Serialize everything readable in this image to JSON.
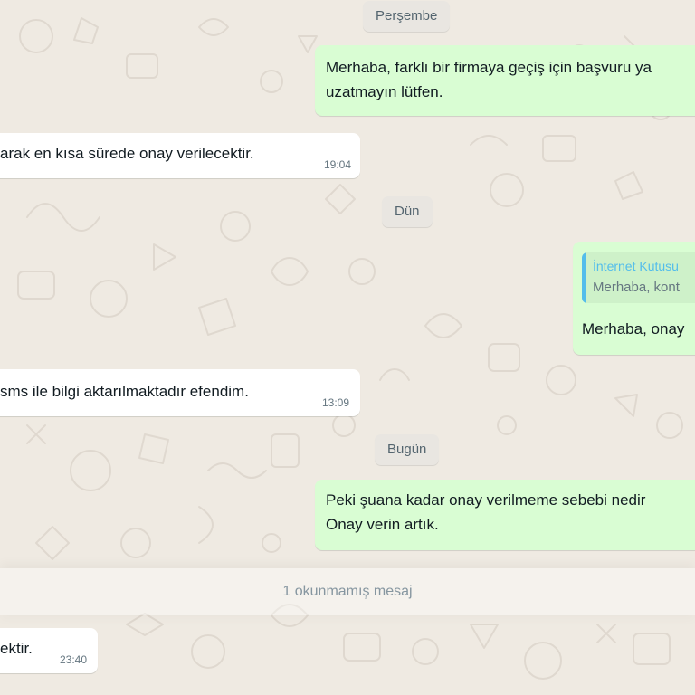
{
  "date_dividers": {
    "thursday": "Perşembe",
    "yesterday": "Dün",
    "today": "Bugün"
  },
  "messages": [
    {
      "direction": "out",
      "lines": [
        "Merhaba, farklı bir firmaya geçiş için başvuru ya",
        "uzatmayın lütfen."
      ]
    },
    {
      "direction": "in",
      "text": "arak en kısa sürede onay verilecektir.",
      "time": "19:04"
    },
    {
      "direction": "out",
      "quote": {
        "author": "İnternet Kutusu",
        "text": "Merhaba, kont"
      },
      "text": "Merhaba, onay"
    },
    {
      "direction": "in",
      "text": "sms ile bilgi aktarılmaktadır efendim.",
      "time": "13:09"
    },
    {
      "direction": "out",
      "lines": [
        "Peki şuana kadar onay verilmeme sebebi nedir",
        "Onay verin artık."
      ]
    },
    {
      "direction": "in",
      "text": "ektir.",
      "time": "23:40"
    }
  ],
  "unread_divider": "1 okunmamış mesaj",
  "colors": {
    "chat_background": "#efeae2",
    "incoming_bubble": "#ffffff",
    "outgoing_bubble": "#d9fdd3",
    "quote_accent": "#53bdeb",
    "timestamp": "#667781"
  }
}
